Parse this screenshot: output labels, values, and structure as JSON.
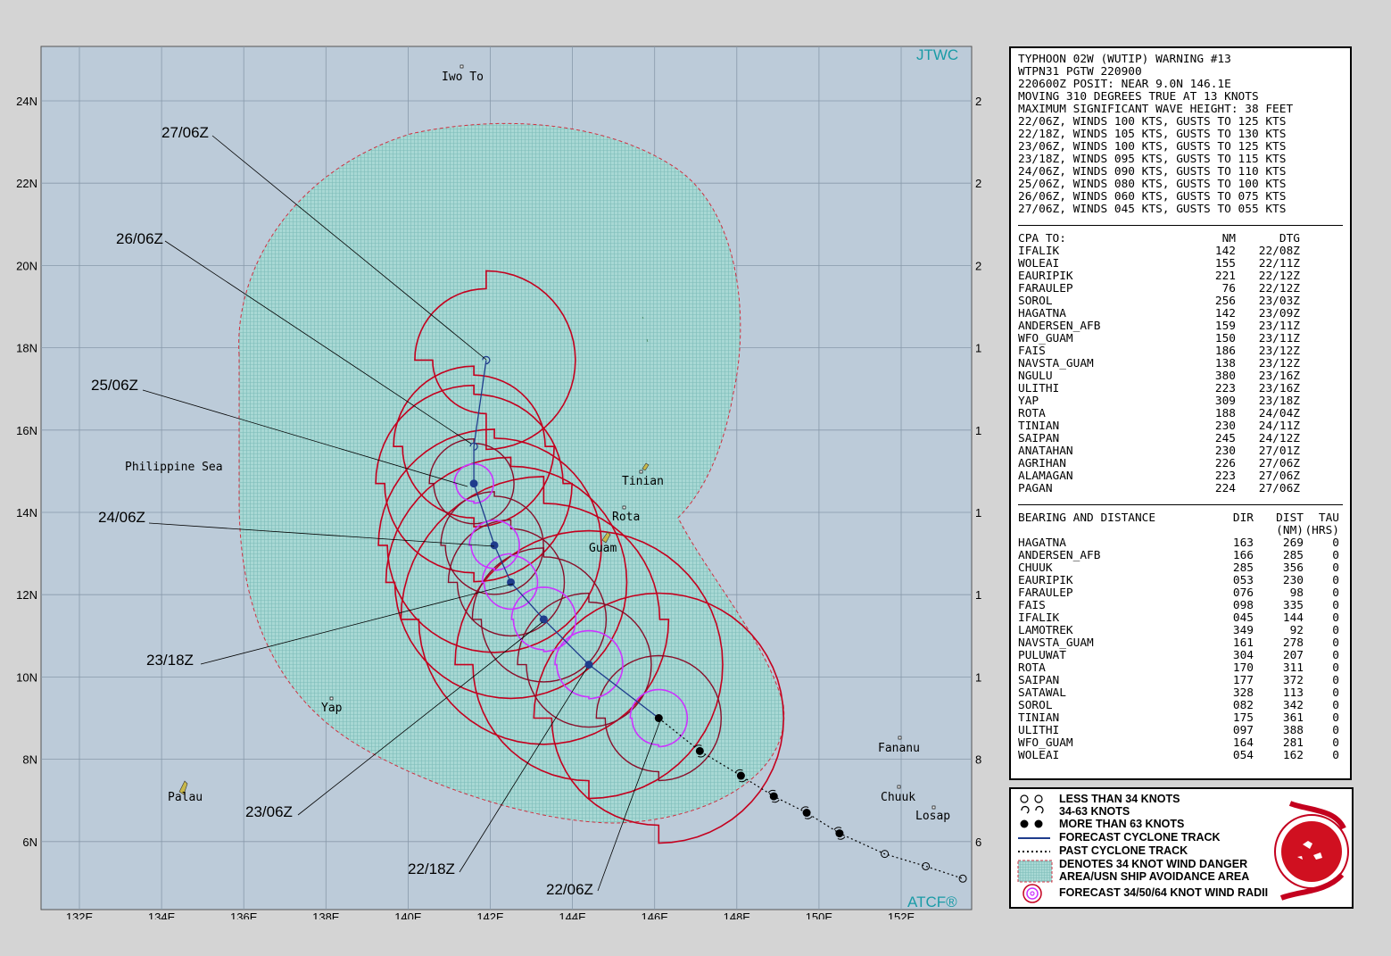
{
  "map": {
    "brand_top": "JTWC",
    "brand_bottom": "ATCF®",
    "lat_labels": [
      "24N",
      "22N",
      "20N",
      "18N",
      "16N",
      "14N",
      "12N",
      "10N",
      "8N",
      "6N"
    ],
    "lon_labels": [
      "132E",
      "134E",
      "136E",
      "138E",
      "140E",
      "142E",
      "144E",
      "146E",
      "148E",
      "150E",
      "152E"
    ],
    "places": {
      "iwo_to": "Iwo To",
      "philippine_sea": "Philippine Sea",
      "tinian": "Tinian",
      "rota": "Rota",
      "guam": "Guam",
      "yap": "Yap",
      "palau": "Palau",
      "fananu": "Fananu",
      "chuuk": "Chuuk",
      "losap": "Losap"
    },
    "tau_labels": {
      "t27": "27/06Z",
      "t26": "26/06Z",
      "t25": "25/06Z",
      "t24": "24/06Z",
      "t2318": "23/18Z",
      "t2306": "23/06Z",
      "t2218": "22/18Z",
      "t2206": "22/06Z"
    },
    "colors": {
      "ocean": "#bccbd9",
      "danger_area": "#a6d6d3",
      "wind_radii_34": "#c4001e",
      "wind_radii_50": "#8a0f2a",
      "wind_radii_64": "#cc33ff",
      "forecast_track": "#1f3c8c",
      "past_track": "#000000",
      "brand": "#1a9ba6"
    },
    "forecast_track": [
      {
        "lat": 9.0,
        "lon": 146.1
      },
      {
        "lat": 10.3,
        "lon": 144.4
      },
      {
        "lat": 11.4,
        "lon": 143.3
      },
      {
        "lat": 12.3,
        "lon": 142.5
      },
      {
        "lat": 13.2,
        "lon": 142.1
      },
      {
        "lat": 14.7,
        "lon": 141.6
      },
      {
        "lat": 15.6,
        "lon": 141.6
      },
      {
        "lat": 17.7,
        "lon": 141.9
      }
    ],
    "past_track": [
      {
        "lat": 8.2,
        "lon": 147.1
      },
      {
        "lat": 7.6,
        "lon": 148.1
      },
      {
        "lat": 7.1,
        "lon": 148.9
      },
      {
        "lat": 6.7,
        "lon": 149.7
      },
      {
        "lat": 6.2,
        "lon": 150.5
      },
      {
        "lat": 5.7,
        "lon": 151.6
      },
      {
        "lat": 5.4,
        "lon": 152.6
      },
      {
        "lat": 5.1,
        "lon": 153.5
      }
    ]
  },
  "warning": {
    "header": [
      "TYPHOON 02W (WUTIP) WARNING #13",
      "WTPN31 PGTW 220900",
      "220600Z POSIT: NEAR 9.0N 146.1E",
      "MOVING 310 DEGREES TRUE AT 13 KNOTS",
      "MAXIMUM SIGNIFICANT WAVE HEIGHT: 38 FEET",
      "22/06Z, WINDS 100 KTS, GUSTS TO 125 KTS",
      "22/18Z, WINDS 105 KTS, GUSTS TO 130 KTS",
      "23/06Z, WINDS 100 KTS, GUSTS TO 125 KTS",
      "23/18Z, WINDS 095 KTS, GUSTS TO 115 KTS",
      "24/06Z, WINDS 090 KTS, GUSTS TO 110 KTS",
      "25/06Z, WINDS 080 KTS, GUSTS TO 100 KTS",
      "26/06Z, WINDS 060 KTS, GUSTS TO 075 KTS",
      "27/06Z, WINDS 045 KTS, GUSTS TO 055 KTS"
    ],
    "cpa_header": {
      "name": "CPA TO:",
      "nm": "NM",
      "dtg": "DTG"
    },
    "cpa_rows": [
      {
        "name": "IFALIK",
        "nm": "142",
        "dtg": "22/08Z"
      },
      {
        "name": "WOLEAI",
        "nm": "155",
        "dtg": "22/11Z"
      },
      {
        "name": "EAURIPIK",
        "nm": "221",
        "dtg": "22/12Z"
      },
      {
        "name": "FARAULEP",
        "nm": "76",
        "dtg": "22/12Z"
      },
      {
        "name": "SOROL",
        "nm": "256",
        "dtg": "23/03Z"
      },
      {
        "name": "HAGATNA",
        "nm": "142",
        "dtg": "23/09Z"
      },
      {
        "name": "ANDERSEN_AFB",
        "nm": "159",
        "dtg": "23/11Z"
      },
      {
        "name": "WFO_GUAM",
        "nm": "150",
        "dtg": "23/11Z"
      },
      {
        "name": "FAIS",
        "nm": "186",
        "dtg": "23/12Z"
      },
      {
        "name": "NAVSTA_GUAM",
        "nm": "138",
        "dtg": "23/12Z"
      },
      {
        "name": "NGULU",
        "nm": "380",
        "dtg": "23/16Z"
      },
      {
        "name": "ULITHI",
        "nm": "223",
        "dtg": "23/16Z"
      },
      {
        "name": "YAP",
        "nm": "309",
        "dtg": "23/18Z"
      },
      {
        "name": "ROTA",
        "nm": "188",
        "dtg": "24/04Z"
      },
      {
        "name": "TINIAN",
        "nm": "230",
        "dtg": "24/11Z"
      },
      {
        "name": "SAIPAN",
        "nm": "245",
        "dtg": "24/12Z"
      },
      {
        "name": "ANATAHAN",
        "nm": "230",
        "dtg": "27/01Z"
      },
      {
        "name": "AGRIHAN",
        "nm": "226",
        "dtg": "27/06Z"
      },
      {
        "name": "ALAMAGAN",
        "nm": "223",
        "dtg": "27/06Z"
      },
      {
        "name": "PAGAN",
        "nm": "224",
        "dtg": "27/06Z"
      }
    ],
    "bd_header": {
      "name": "BEARING AND DISTANCE",
      "dir": "DIR",
      "dist": "DIST",
      "tau": "TAU",
      "dist_unit": "(NM)",
      "tau_unit": "(HRS)"
    },
    "bd_rows": [
      {
        "name": "HAGATNA",
        "dir": "163",
        "dist": "269",
        "tau": "0"
      },
      {
        "name": "ANDERSEN_AFB",
        "dir": "166",
        "dist": "285",
        "tau": "0"
      },
      {
        "name": "CHUUK",
        "dir": "285",
        "dist": "356",
        "tau": "0"
      },
      {
        "name": "EAURIPIK",
        "dir": "053",
        "dist": "230",
        "tau": "0"
      },
      {
        "name": "FARAULEP",
        "dir": "076",
        "dist": "98",
        "tau": "0"
      },
      {
        "name": "FAIS",
        "dir": "098",
        "dist": "335",
        "tau": "0"
      },
      {
        "name": "IFALIK",
        "dir": "045",
        "dist": "144",
        "tau": "0"
      },
      {
        "name": "LAMOTREK",
        "dir": "349",
        "dist": "92",
        "tau": "0"
      },
      {
        "name": "NAVSTA_GUAM",
        "dir": "161",
        "dist": "278",
        "tau": "0"
      },
      {
        "name": "PULUWAT",
        "dir": "304",
        "dist": "207",
        "tau": "0"
      },
      {
        "name": "ROTA",
        "dir": "170",
        "dist": "311",
        "tau": "0"
      },
      {
        "name": "SAIPAN",
        "dir": "177",
        "dist": "372",
        "tau": "0"
      },
      {
        "name": "SATAWAL",
        "dir": "328",
        "dist": "113",
        "tau": "0"
      },
      {
        "name": "SOROL",
        "dir": "082",
        "dist": "342",
        "tau": "0"
      },
      {
        "name": "TINIAN",
        "dir": "175",
        "dist": "361",
        "tau": "0"
      },
      {
        "name": "ULITHI",
        "dir": "097",
        "dist": "388",
        "tau": "0"
      },
      {
        "name": "WFO_GUAM",
        "dir": "164",
        "dist": "281",
        "tau": "0"
      },
      {
        "name": "WOLEAI",
        "dir": "054",
        "dist": "162",
        "tau": "0"
      }
    ]
  },
  "legend": {
    "less_34": "LESS THAN 34 KNOTS",
    "k34_63": "34-63 KNOTS",
    "more_63": "MORE THAN 63 KNOTS",
    "forecast_track": "FORECAST CYCLONE TRACK",
    "past_track": "PAST CYCLONE  TRACK",
    "danger_1": "DENOTES 34 KNOT WIND DANGER",
    "danger_2": "AREA/USN SHIP AVOIDANCE AREA",
    "radii": "FORECAST 34/50/64 KNOT WIND RADII"
  }
}
